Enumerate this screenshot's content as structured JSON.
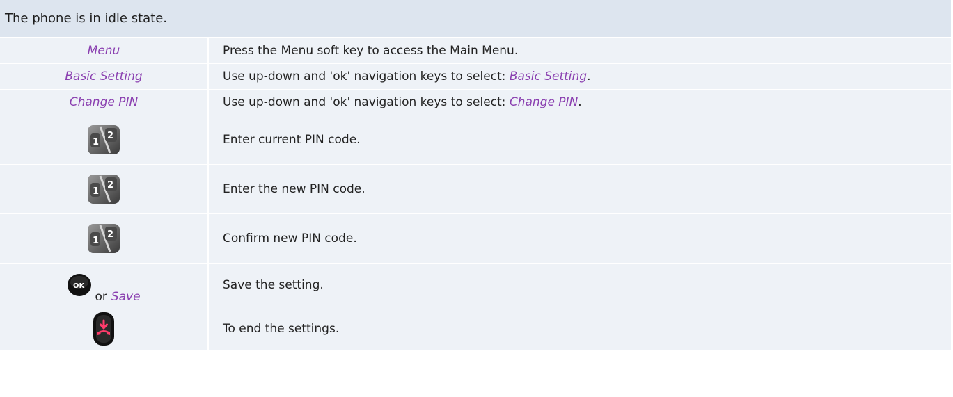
{
  "header": {
    "text": "The phone is in idle state."
  },
  "rows": [
    {
      "key": "Menu",
      "desc": "Press the Menu soft key to access the Main Menu."
    },
    {
      "key": "Basic Setting",
      "desc_prefix": "Use up-down and 'ok' navigation keys to select: ",
      "desc_em": "Basic Setting",
      "desc_suffix": "."
    },
    {
      "key": "Change PIN",
      "desc_prefix": "Use up-down and 'ok' navigation keys to select: ",
      "desc_em": "Change PIN",
      "desc_suffix": "."
    },
    {
      "icon": "keypad-icon",
      "desc": "Enter current PIN code."
    },
    {
      "icon": "keypad-icon",
      "desc": "Enter the new PIN code."
    },
    {
      "icon": "keypad-icon",
      "desc": "Confirm new PIN code."
    },
    {
      "icon": "ok-button-icon",
      "or": "or",
      "key": "Save",
      "desc": "Save the setting."
    },
    {
      "icon": "hang-up-key-icon",
      "desc": "To end the settings."
    }
  ],
  "colors": {
    "header_bg": "#dde5ef",
    "row_bg": "#eef2f7",
    "softkey_text": "#8a3fb0"
  }
}
